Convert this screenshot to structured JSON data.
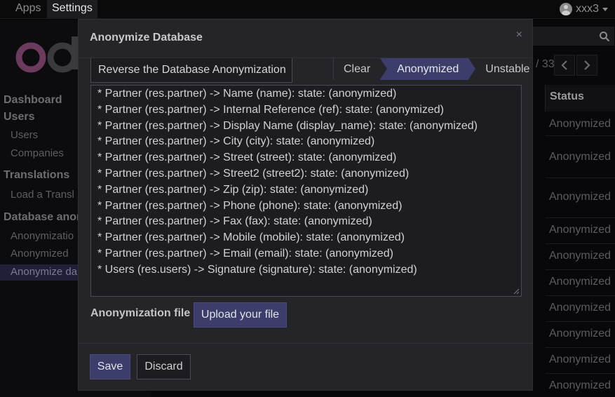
{
  "topbar": {
    "apps_label": "Apps",
    "settings_label": "Settings",
    "user_name": "xxx3"
  },
  "sidebar": {
    "sections": [
      {
        "title": "Dashboard",
        "items": []
      },
      {
        "title": "Users",
        "items": [
          "Users",
          "Companies"
        ]
      },
      {
        "title": "Translations",
        "items": [
          "Load a Transl"
        ]
      },
      {
        "title": "Database anon",
        "items": [
          "Anonymizatio",
          "Anonymized",
          "Anonymize da"
        ]
      }
    ]
  },
  "list": {
    "pager_total": "/ 33",
    "status_header": "Status",
    "rows": [
      "Anonymized",
      "Anonymized",
      "Anonymized",
      "Anonymized",
      "Anonymized",
      "Anonymized",
      "Anonymized",
      "Anonymized",
      "Anonymized",
      "Anonymized"
    ]
  },
  "modal": {
    "title": "Anonymize Database",
    "close": "×",
    "reverse_button": "Reverse the Database Anonymization",
    "stages": [
      "Clear",
      "Anonymized",
      "Unstable"
    ],
    "active_stage": "Anonymized",
    "summary_lines": [
      "* Partner (res.partner) -> Name (name): state: (anonymized)",
      "* Partner (res.partner) -> Internal Reference (ref): state: (anonymized)",
      "* Partner (res.partner) -> Display Name (display_name): state: (anonymized)",
      "* Partner (res.partner) -> City (city): state: (anonymized)",
      "* Partner (res.partner) -> Street (street): state: (anonymized)",
      "* Partner (res.partner) -> Street2 (street2): state: (anonymized)",
      "* Partner (res.partner) -> Zip (zip): state: (anonymized)",
      "* Partner (res.partner) -> Phone (phone): state: (anonymized)",
      "* Partner (res.partner) -> Fax (fax): state: (anonymized)",
      "* Partner (res.partner) -> Mobile (mobile): state: (anonymized)",
      "* Partner (res.partner) -> Email (email): state: (anonymized)",
      "* Users (res.users) -> Signature (signature): state: (anonymized)"
    ],
    "file_label": "Anonymization file",
    "upload_button": "Upload your file",
    "save_button": "Save",
    "discard_button": "Discard"
  },
  "colors": {
    "primary": "#3d3d6b",
    "modal_bg": "#252529",
    "field_bg": "#1d1d21"
  }
}
